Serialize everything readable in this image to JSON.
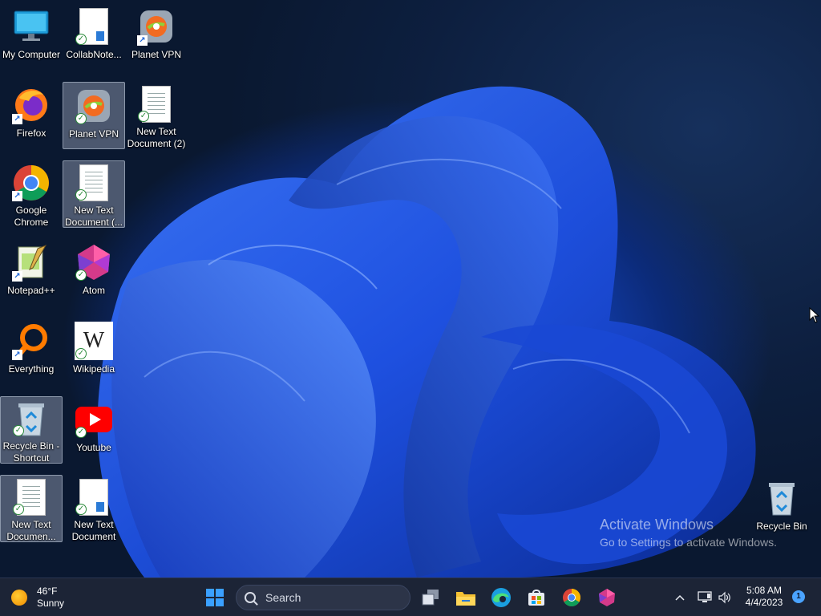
{
  "desktop": {
    "icons": [
      {
        "label": "My Computer"
      },
      {
        "label": "CollabNote..."
      },
      {
        "label": "Planet VPN"
      },
      {
        "label": "Firefox"
      },
      {
        "label": "Planet VPN"
      },
      {
        "label": "New Text Document (2)"
      },
      {
        "label": "Google Chrome"
      },
      {
        "label": "New Text Document (..."
      },
      {
        "label": "Notepad++"
      },
      {
        "label": "Atom"
      },
      {
        "label": "Everything"
      },
      {
        "label": "Wikipedia"
      },
      {
        "label": "Recycle Bin - Shortcut"
      },
      {
        "label": "Youtube"
      },
      {
        "label": "New Text Documen..."
      },
      {
        "label": "New Text Document"
      },
      {
        "label": "Recycle Bin"
      }
    ],
    "watermark": {
      "title": "Activate Windows",
      "subtitle": "Go to Settings to activate Windows."
    },
    "wikipedia_glyph": "W"
  },
  "taskbar": {
    "weather": {
      "temp": "46°F",
      "condition": "Sunny"
    },
    "search": {
      "placeholder": "Search"
    },
    "clock": {
      "time": "5:08 AM",
      "date": "4/4/2023"
    },
    "notification_count": "1"
  }
}
